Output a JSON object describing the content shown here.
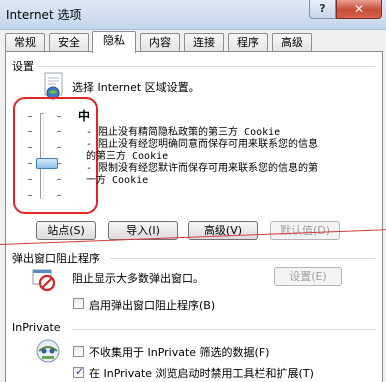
{
  "window": {
    "title": "Internet 选项",
    "help_label": "?",
    "close_label": "✕"
  },
  "tabs": [
    {
      "label": "常规"
    },
    {
      "label": "安全"
    },
    {
      "label": "隐私"
    },
    {
      "label": "内容"
    },
    {
      "label": "连接"
    },
    {
      "label": "程序"
    },
    {
      "label": "高级"
    }
  ],
  "settings": {
    "group_label": "设置",
    "select_zone_text": "选择 Internet 区域设置。",
    "level": "中",
    "descriptions": [
      "- 阻止没有精简隐私政策的第三方 Cookie",
      "- 阻止没有经您明确同意而保存可用来联系您的信息",
      "的第三方 Cookie",
      "- 限制没有经您默许而保存可用来联系您的信息的第",
      "一方 Cookie"
    ],
    "buttons": {
      "sites": "站点(S)",
      "import": "导入(I)",
      "advanced": "高级(V)",
      "default": "默认值(D)"
    }
  },
  "popup": {
    "group_label": "弹出窗口阻止程序",
    "text": "阻止显示大多数弹出窗口。",
    "settings_button": "设置(E)",
    "enable_label": "启用弹出窗口阻止程序(B)",
    "enable_checked": false
  },
  "inprivate": {
    "group_label": "InPrivate",
    "no_collect_label": "不收集用于 InPrivate 筛选的数据(F)",
    "no_collect_checked": false,
    "disable_toolbars_label": "在 InPrivate 浏览启动时禁用工具栏和扩展(T)",
    "disable_toolbars_checked": true
  },
  "colors": {
    "highlight": "#e0242a",
    "accent": "#3c7fb1"
  }
}
